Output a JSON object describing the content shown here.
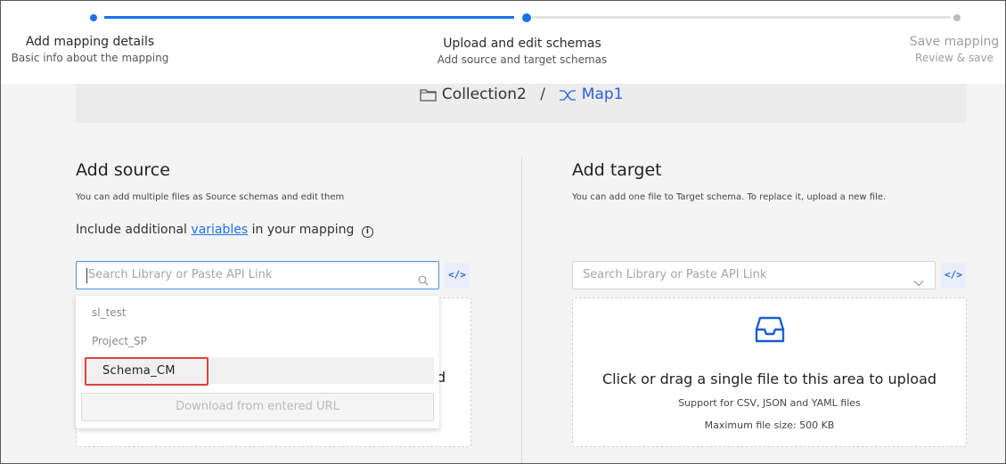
{
  "stepper": {
    "steps": [
      {
        "title": "Add mapping details",
        "subtitle": "Basic info about the mapping",
        "state": "done"
      },
      {
        "title": "Upload and edit schemas",
        "subtitle": "Add source and target schemas",
        "state": "current"
      },
      {
        "title": "Save mapping",
        "subtitle": "Review & save",
        "state": "upcoming"
      }
    ]
  },
  "breadcrumb": {
    "collection": "Collection2",
    "separator": "/",
    "map": "Map1",
    "collection_icon": "folder-icon",
    "map_icon": "shuffle-icon"
  },
  "source": {
    "heading": "Add source",
    "description": "You can add multiple files as Source schemas and edit them",
    "vars_prefix": "Include additional",
    "vars_link": "variables",
    "vars_suffix": "in your mapping",
    "info_glyph": "i",
    "search_placeholder": "Search Library or Paste API Link",
    "code_button": "</>",
    "partial_text": "d",
    "dropdown": {
      "options": [
        "sl_test",
        "Project_SP",
        "Schema_CM"
      ],
      "highlighted": "Schema_CM",
      "download_label": "Download from entered URL"
    }
  },
  "target": {
    "heading": "Add target",
    "description": "You can add one file to Target schema. To replace it, upload a new file.",
    "search_placeholder": "Search Library or Paste API Link",
    "code_button": "</>",
    "upload_title": "Click or drag a single file to this area to upload",
    "upload_formats": "Support for CSV, JSON and YAML files",
    "upload_max": "Maximum file size: 500 KB",
    "upload_icon": "inbox-icon"
  },
  "colors": {
    "accent": "#1a73e8",
    "link": "#2b5fd9",
    "highlight_border": "#e04040"
  }
}
